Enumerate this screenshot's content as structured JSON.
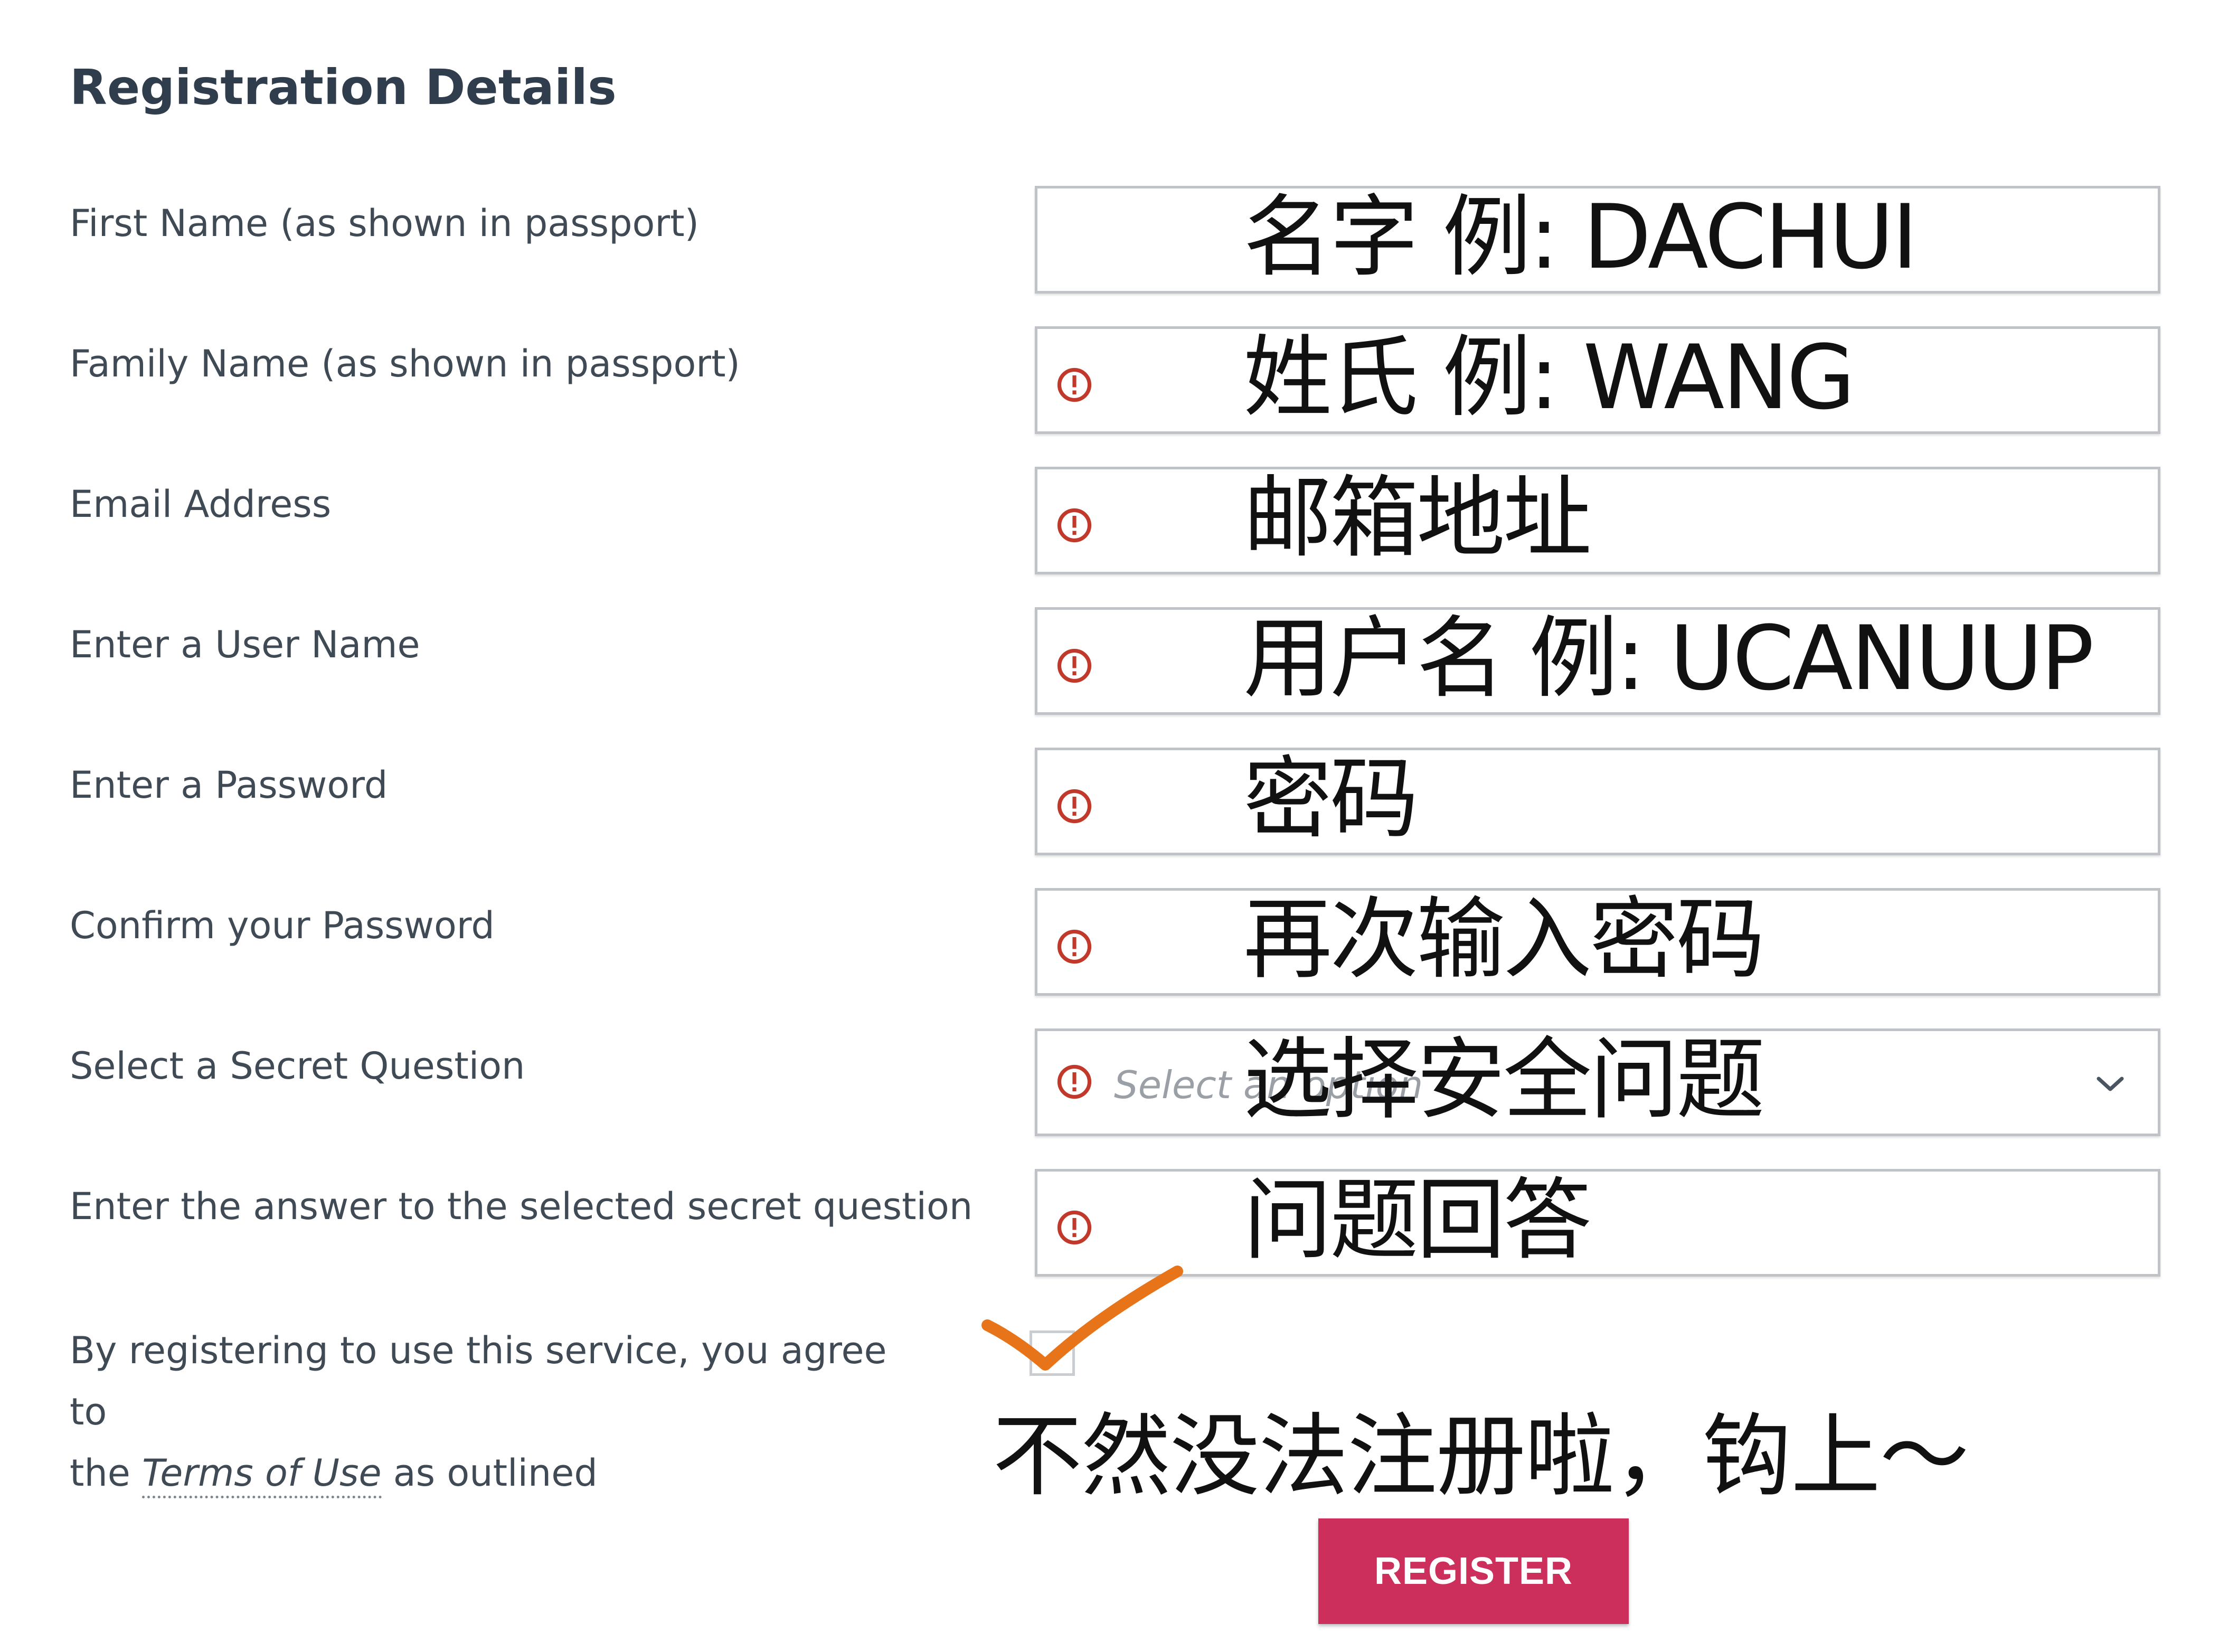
{
  "form": {
    "title": "Registration Details",
    "fields": [
      {
        "label": "First Name (as shown in passport)",
        "overlay": "名字 例: DACHUI",
        "error": false
      },
      {
        "label": "Family Name (as shown in passport)",
        "overlay": "姓氏 例: WANG",
        "error": true
      },
      {
        "label": "Email Address",
        "overlay": "邮箱地址",
        "error": true
      },
      {
        "label": "Enter a User Name",
        "overlay": "用户名 例: UCANUUP",
        "error": true
      },
      {
        "label": "Enter a Password",
        "overlay": "密码",
        "error": true
      },
      {
        "label": "Confirm your Password",
        "overlay": "再次输入密码",
        "error": true
      },
      {
        "label": "Select a Secret Question",
        "overlay": "选择安全问题",
        "placeholder": "Select an option",
        "error": true,
        "type": "select"
      },
      {
        "label": "Enter the answer to the selected secret question",
        "overlay": "问题回答",
        "error": true
      }
    ],
    "terms": {
      "line1": "By registering to use this service, you agree to",
      "pre": "the",
      "link": "Terms of Use",
      "post": "as outlined"
    },
    "checkbox_hint": "不然没法注册啦，钩上～",
    "register_label": "REGISTER"
  },
  "colors": {
    "accent": "#cc2f5c",
    "error": "#c0392b",
    "annotation": "#e8741a"
  },
  "icons": {
    "error": "error-circle-icon",
    "dropdown": "chevron-down-icon",
    "annotation": "checkmark-annotation-icon"
  }
}
